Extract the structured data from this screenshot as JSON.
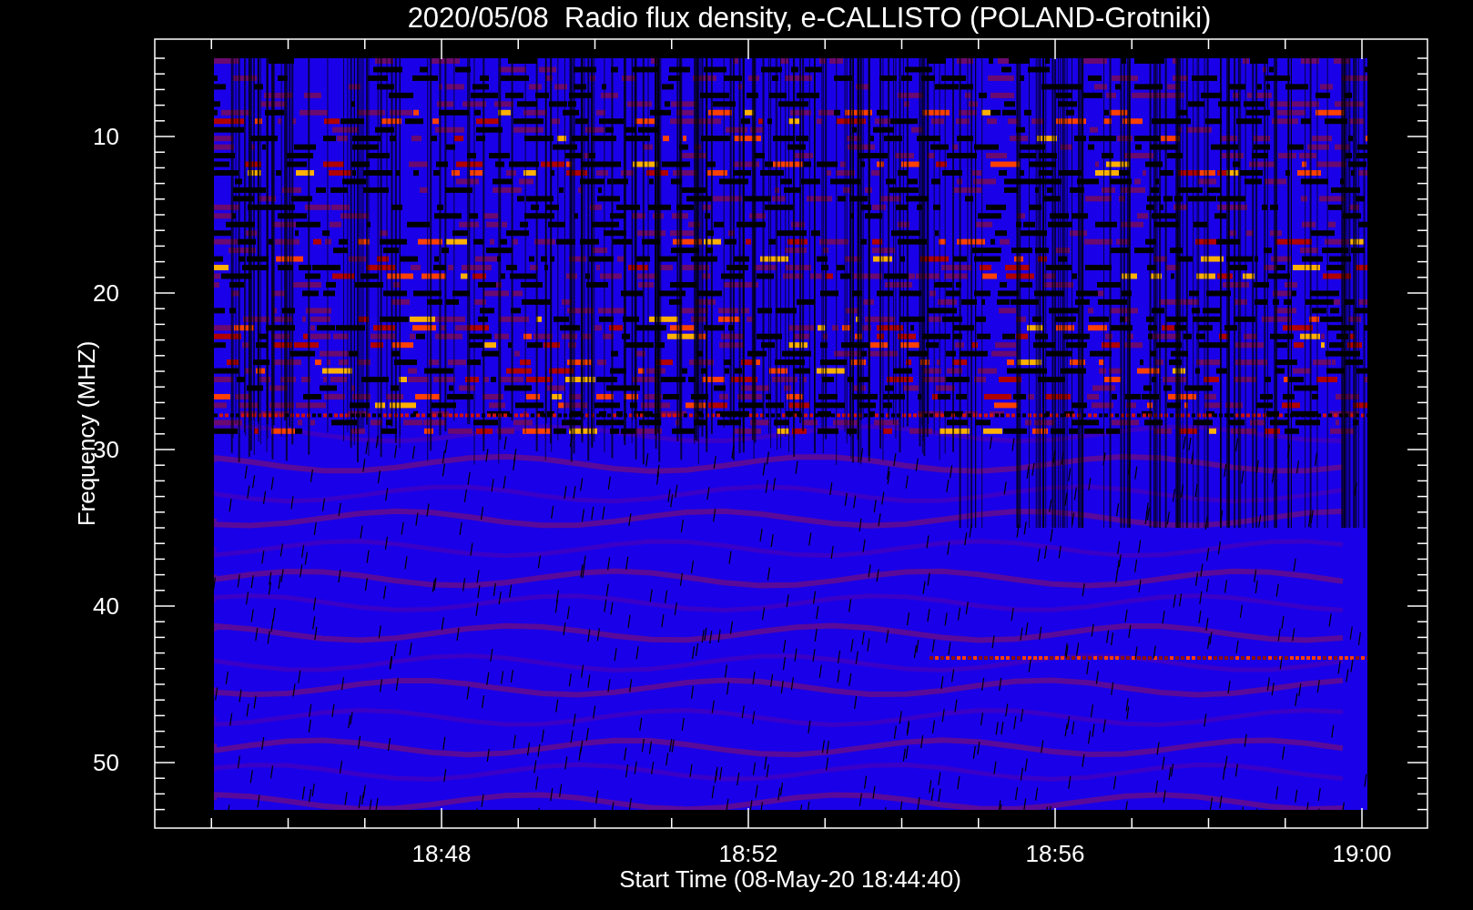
{
  "title": "2020/05/08  Radio flux density, e-CALLISTO (POLAND-Grotniki)",
  "y_axis": {
    "label": "Frequency (MHZ)",
    "ticks": [
      "10",
      "20",
      "30",
      "40",
      "50"
    ]
  },
  "x_axis": {
    "label": "Start Time (08-May-20 18:44:40)",
    "ticks": [
      "18:48",
      "18:52",
      "18:56",
      "19:00"
    ]
  }
}
